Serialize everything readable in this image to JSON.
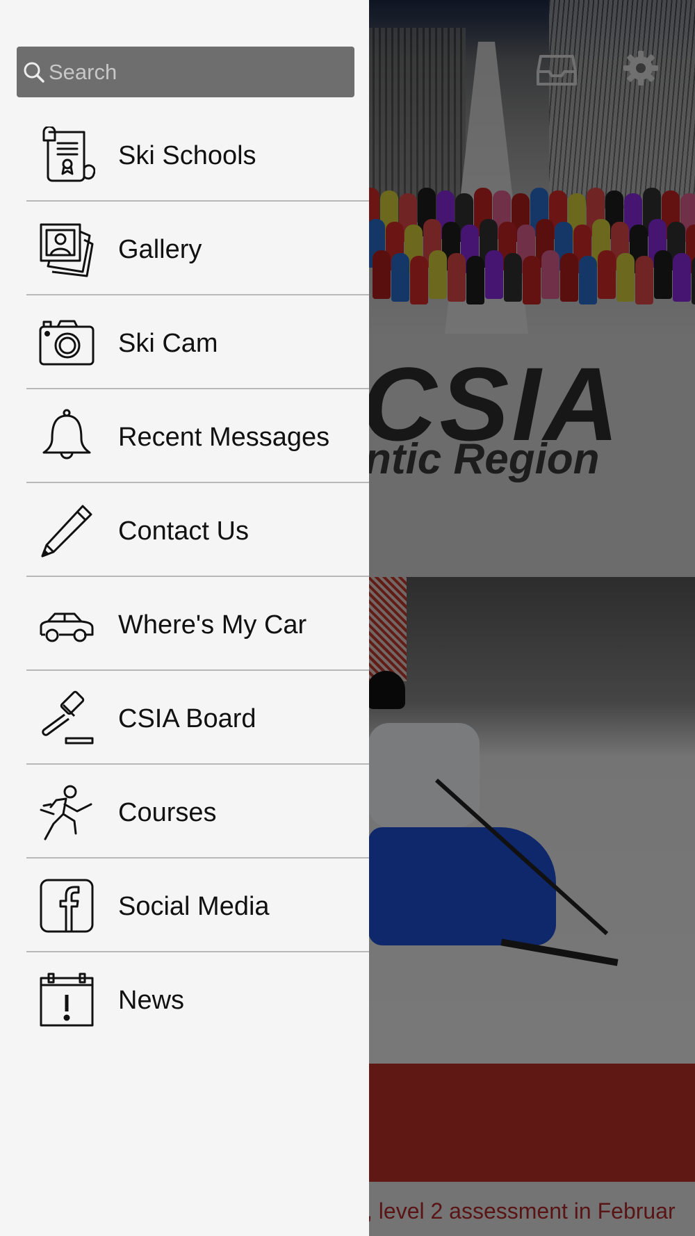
{
  "background": {
    "logo_text": "CSIA",
    "logo_subtext": "ntic Region",
    "ticker_text": ", level 2 assessment in Februar",
    "header_icons": [
      "inbox-icon",
      "gear-icon"
    ],
    "colors": {
      "accent_red": "#c0302b",
      "ticker_text": "#b3282a"
    }
  },
  "drawer": {
    "search": {
      "placeholder": "Search",
      "value": ""
    },
    "items": [
      {
        "label": "Ski Schools",
        "icon": "scroll-certificate-icon"
      },
      {
        "label": "Gallery",
        "icon": "photo-gallery-icon"
      },
      {
        "label": "Ski Cam",
        "icon": "camera-icon"
      },
      {
        "label": "Recent Messages",
        "icon": "bell-icon"
      },
      {
        "label": "Contact Us",
        "icon": "pencil-icon"
      },
      {
        "label": "Where's My Car",
        "icon": "car-icon"
      },
      {
        "label": "CSIA Board",
        "icon": "gavel-icon"
      },
      {
        "label": "Courses",
        "icon": "runner-icon"
      },
      {
        "label": "Social Media",
        "icon": "facebook-icon"
      },
      {
        "label": "News",
        "icon": "calendar-alert-icon"
      }
    ]
  }
}
